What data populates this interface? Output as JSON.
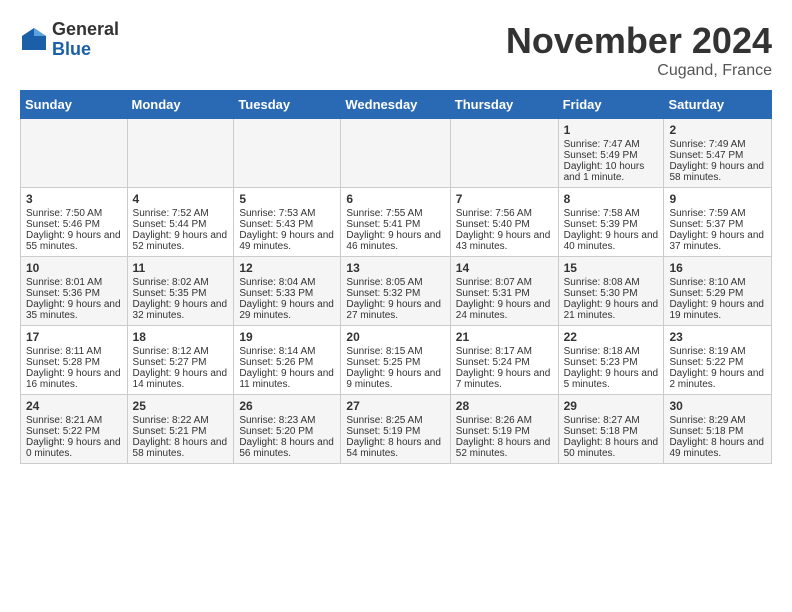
{
  "logo": {
    "general": "General",
    "blue": "Blue"
  },
  "title": "November 2024",
  "location": "Cugand, France",
  "days_of_week": [
    "Sunday",
    "Monday",
    "Tuesday",
    "Wednesday",
    "Thursday",
    "Friday",
    "Saturday"
  ],
  "weeks": [
    [
      {
        "day": "",
        "data": ""
      },
      {
        "day": "",
        "data": ""
      },
      {
        "day": "",
        "data": ""
      },
      {
        "day": "",
        "data": ""
      },
      {
        "day": "",
        "data": ""
      },
      {
        "day": "1",
        "data": "Sunrise: 7:47 AM\nSunset: 5:49 PM\nDaylight: 10 hours and 1 minute."
      },
      {
        "day": "2",
        "data": "Sunrise: 7:49 AM\nSunset: 5:47 PM\nDaylight: 9 hours and 58 minutes."
      }
    ],
    [
      {
        "day": "3",
        "data": "Sunrise: 7:50 AM\nSunset: 5:46 PM\nDaylight: 9 hours and 55 minutes."
      },
      {
        "day": "4",
        "data": "Sunrise: 7:52 AM\nSunset: 5:44 PM\nDaylight: 9 hours and 52 minutes."
      },
      {
        "day": "5",
        "data": "Sunrise: 7:53 AM\nSunset: 5:43 PM\nDaylight: 9 hours and 49 minutes."
      },
      {
        "day": "6",
        "data": "Sunrise: 7:55 AM\nSunset: 5:41 PM\nDaylight: 9 hours and 46 minutes."
      },
      {
        "day": "7",
        "data": "Sunrise: 7:56 AM\nSunset: 5:40 PM\nDaylight: 9 hours and 43 minutes."
      },
      {
        "day": "8",
        "data": "Sunrise: 7:58 AM\nSunset: 5:39 PM\nDaylight: 9 hours and 40 minutes."
      },
      {
        "day": "9",
        "data": "Sunrise: 7:59 AM\nSunset: 5:37 PM\nDaylight: 9 hours and 37 minutes."
      }
    ],
    [
      {
        "day": "10",
        "data": "Sunrise: 8:01 AM\nSunset: 5:36 PM\nDaylight: 9 hours and 35 minutes."
      },
      {
        "day": "11",
        "data": "Sunrise: 8:02 AM\nSunset: 5:35 PM\nDaylight: 9 hours and 32 minutes."
      },
      {
        "day": "12",
        "data": "Sunrise: 8:04 AM\nSunset: 5:33 PM\nDaylight: 9 hours and 29 minutes."
      },
      {
        "day": "13",
        "data": "Sunrise: 8:05 AM\nSunset: 5:32 PM\nDaylight: 9 hours and 27 minutes."
      },
      {
        "day": "14",
        "data": "Sunrise: 8:07 AM\nSunset: 5:31 PM\nDaylight: 9 hours and 24 minutes."
      },
      {
        "day": "15",
        "data": "Sunrise: 8:08 AM\nSunset: 5:30 PM\nDaylight: 9 hours and 21 minutes."
      },
      {
        "day": "16",
        "data": "Sunrise: 8:10 AM\nSunset: 5:29 PM\nDaylight: 9 hours and 19 minutes."
      }
    ],
    [
      {
        "day": "17",
        "data": "Sunrise: 8:11 AM\nSunset: 5:28 PM\nDaylight: 9 hours and 16 minutes."
      },
      {
        "day": "18",
        "data": "Sunrise: 8:12 AM\nSunset: 5:27 PM\nDaylight: 9 hours and 14 minutes."
      },
      {
        "day": "19",
        "data": "Sunrise: 8:14 AM\nSunset: 5:26 PM\nDaylight: 9 hours and 11 minutes."
      },
      {
        "day": "20",
        "data": "Sunrise: 8:15 AM\nSunset: 5:25 PM\nDaylight: 9 hours and 9 minutes."
      },
      {
        "day": "21",
        "data": "Sunrise: 8:17 AM\nSunset: 5:24 PM\nDaylight: 9 hours and 7 minutes."
      },
      {
        "day": "22",
        "data": "Sunrise: 8:18 AM\nSunset: 5:23 PM\nDaylight: 9 hours and 5 minutes."
      },
      {
        "day": "23",
        "data": "Sunrise: 8:19 AM\nSunset: 5:22 PM\nDaylight: 9 hours and 2 minutes."
      }
    ],
    [
      {
        "day": "24",
        "data": "Sunrise: 8:21 AM\nSunset: 5:22 PM\nDaylight: 9 hours and 0 minutes."
      },
      {
        "day": "25",
        "data": "Sunrise: 8:22 AM\nSunset: 5:21 PM\nDaylight: 8 hours and 58 minutes."
      },
      {
        "day": "26",
        "data": "Sunrise: 8:23 AM\nSunset: 5:20 PM\nDaylight: 8 hours and 56 minutes."
      },
      {
        "day": "27",
        "data": "Sunrise: 8:25 AM\nSunset: 5:19 PM\nDaylight: 8 hours and 54 minutes."
      },
      {
        "day": "28",
        "data": "Sunrise: 8:26 AM\nSunset: 5:19 PM\nDaylight: 8 hours and 52 minutes."
      },
      {
        "day": "29",
        "data": "Sunrise: 8:27 AM\nSunset: 5:18 PM\nDaylight: 8 hours and 50 minutes."
      },
      {
        "day": "30",
        "data": "Sunrise: 8:29 AM\nSunset: 5:18 PM\nDaylight: 8 hours and 49 minutes."
      }
    ]
  ]
}
